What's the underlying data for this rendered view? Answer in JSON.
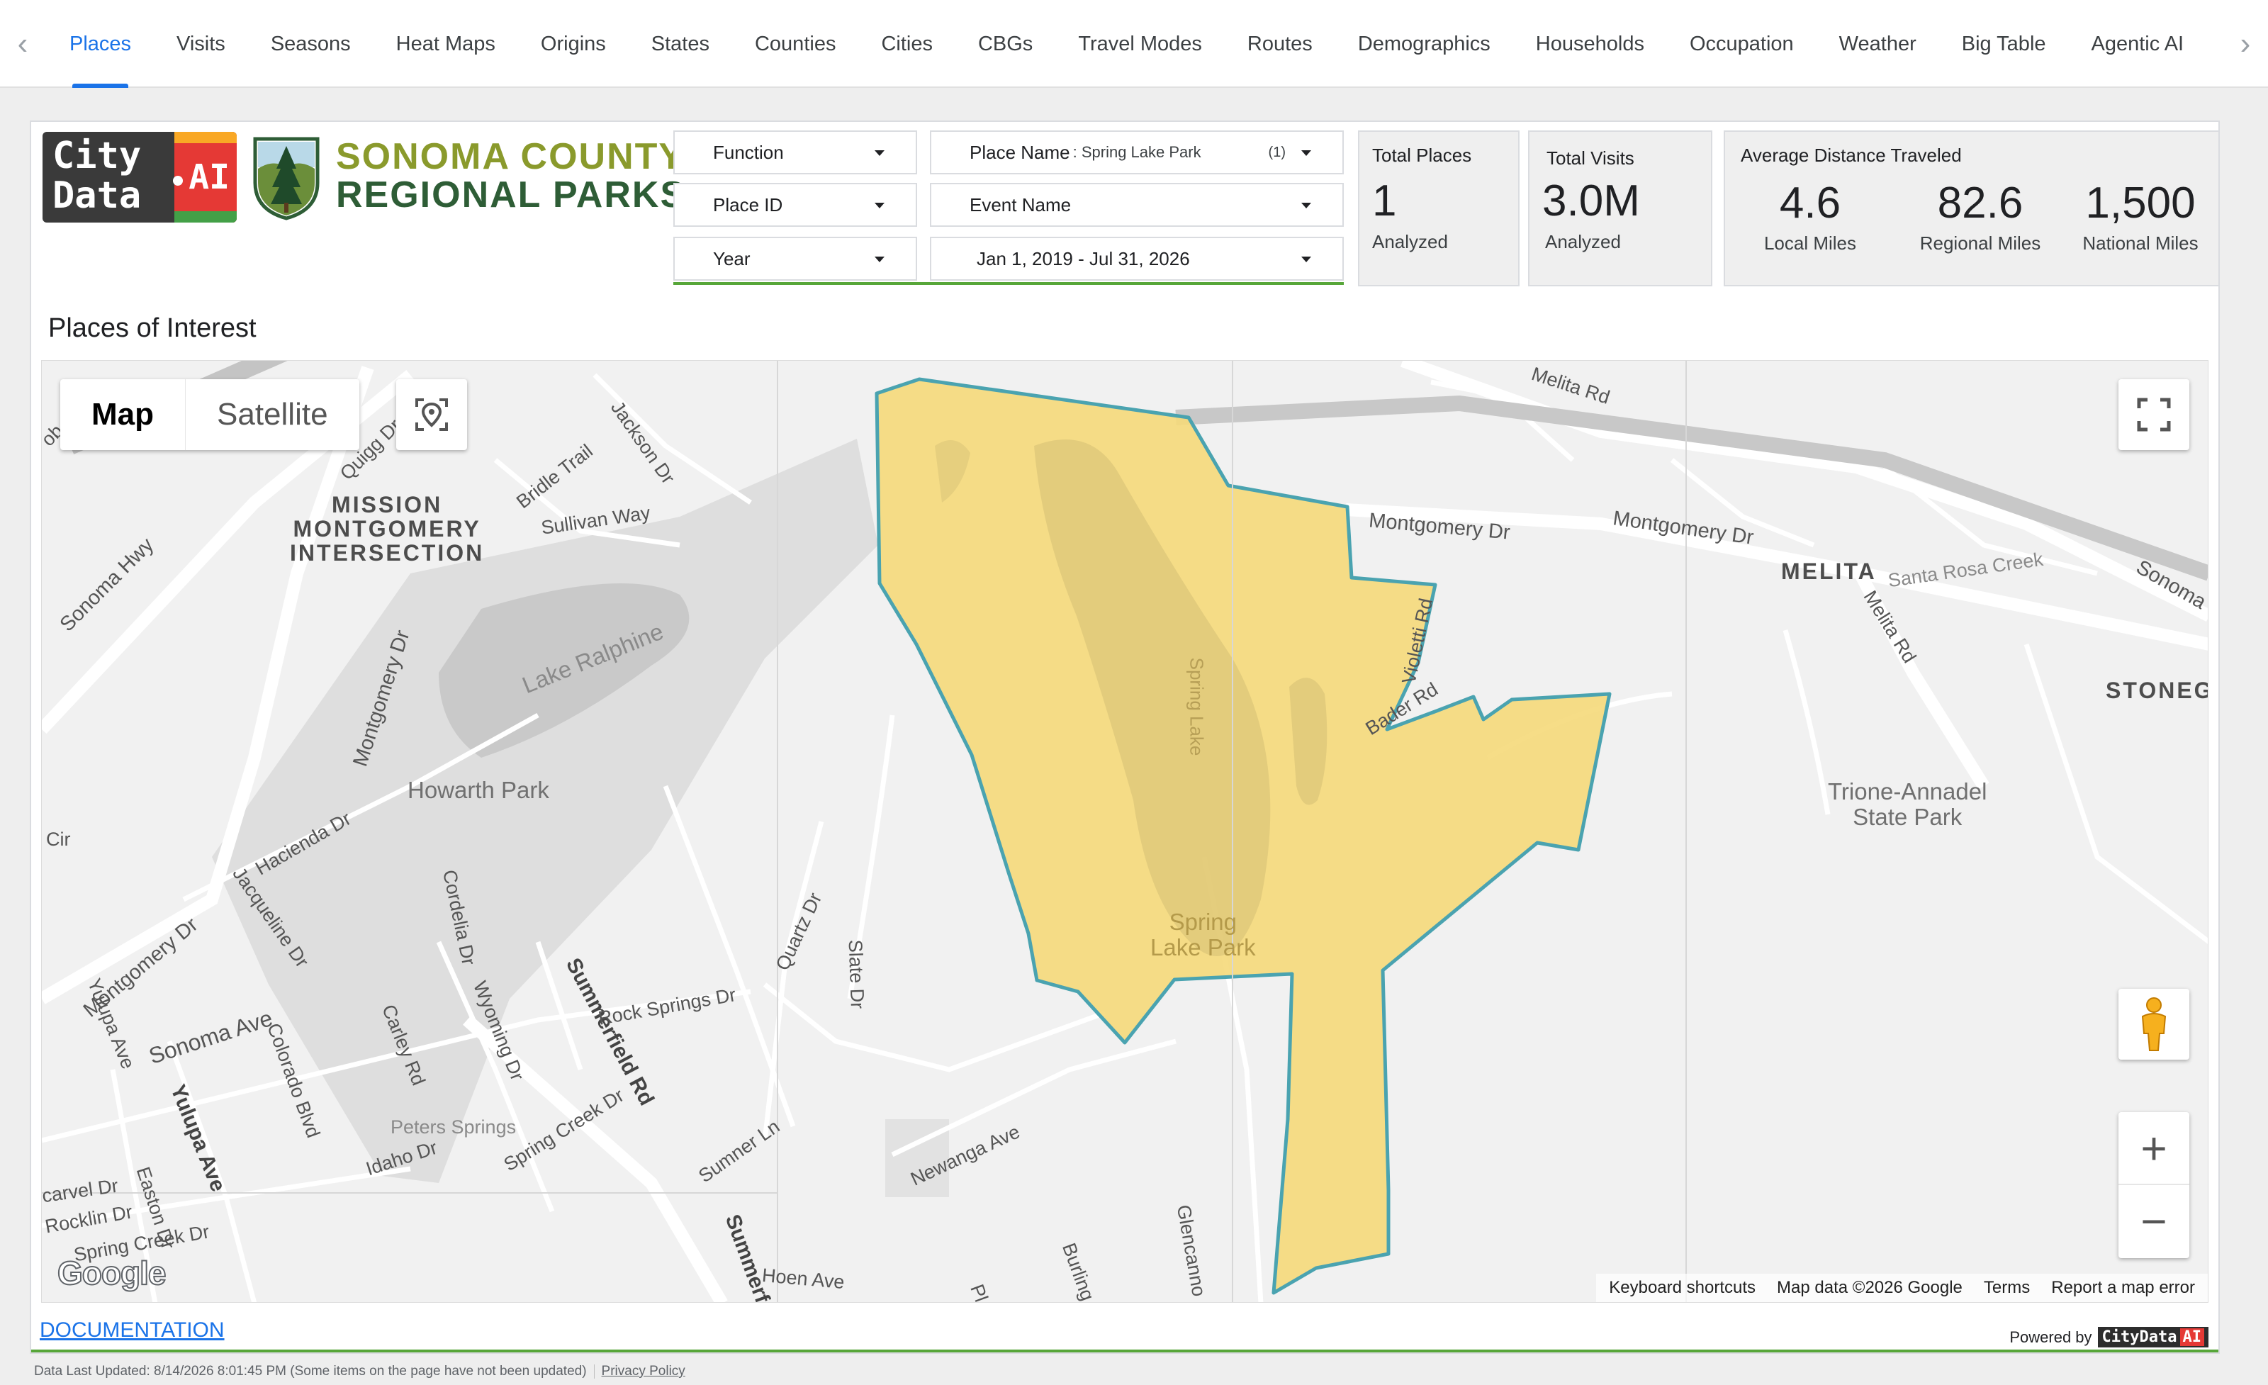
{
  "nav": {
    "tabs": [
      "Places",
      "Visits",
      "Seasons",
      "Heat Maps",
      "Origins",
      "States",
      "Counties",
      "Cities",
      "CBGs",
      "Travel Modes",
      "Routes",
      "Demographics",
      "Households",
      "Occupation",
      "Weather",
      "Big Table",
      "Agentic AI"
    ],
    "active_index": 0
  },
  "branding": {
    "citydata_logo_text": "City\nData",
    "citydata_logo_ai": "AI",
    "org_line1": "SONOMA COUNTY",
    "org_line2": "REGIONAL PARKS"
  },
  "filters": {
    "function": "Function",
    "place_name_label": "Place Name",
    "place_name_value": ": Spring Lake Park",
    "place_name_count": "(1)",
    "place_id": "Place ID",
    "event_name": "Event Name",
    "year": "Year",
    "date_range": "Jan 1, 2019 - Jul 31, 2026"
  },
  "stats": {
    "total_places": {
      "title": "Total Places",
      "value": "1",
      "label": "Analyzed"
    },
    "total_visits": {
      "title": "Total Visits",
      "value": "3.0M",
      "label": "Analyzed"
    },
    "avg_distance": {
      "title": "Average Distance Traveled",
      "local": {
        "value": "4.6",
        "label": "Local Miles"
      },
      "regional": {
        "value": "82.6",
        "label": "Regional Miles"
      },
      "national": {
        "value": "1,500",
        "label": "National Miles"
      }
    }
  },
  "section_title": "Places of Interest",
  "map": {
    "type_map": "Map",
    "type_satellite": "Satellite",
    "polygon_fill": "#f5d97a",
    "polygon_stroke": "#4aa3b0",
    "labels": {
      "mission": "MISSION\nMONTGOMERY\nINTERSECTION",
      "melita": "MELITA",
      "stoneg": "STONEG",
      "lake_ralphine": "Lake Ralphine",
      "howarth_park": "Howarth Park",
      "spring_lake_park": "Spring\nLake Park",
      "spring_lake": "Spring Lake",
      "trione": "Trione-Annadel\nState Park",
      "peters_springs": "Peters Springs",
      "sonoma_hwy": "Sonoma Hwy",
      "montgomery_dr_1": "Montgomery Dr",
      "montgomery_dr_2": "Montgomery Dr",
      "montgomery_dr_3": "Montgomery Dr",
      "montgomery_dr_4": "Montgomery Dr",
      "melita_rd_1": "Melita Rd",
      "melita_rd_2": "Melita Rd",
      "santa_rosa_creek": "Santa Rosa Creek",
      "sonoma_right": "Sonoma",
      "quigg_dr": "Quigg Dr",
      "bridle_trail": "Bridle Trail",
      "jackson_dr": "Jackson Dr",
      "sullivan_way": "Sullivan Way",
      "violetti_rd": "Violetti Rd",
      "bader_rd": "Bader Rd",
      "hacienda_dr": "Hacienda Dr",
      "jacqueline_dr": "Jacqueline Dr",
      "cordelia_dr": "Cordelia Dr",
      "summerfield_rd": "Summerfield Rd",
      "summerfield_bottom": "Summerf",
      "quartz_dr": "Quartz Dr",
      "slate_dr": "Slate Dr",
      "rock_springs_dr": "Rock Springs Dr",
      "sonoma_ave": "Sonoma Ave",
      "yulupa_ave_1": "Yulupa Ave",
      "yulupa_ave_2": "Yulupa Ave",
      "colorado_blvd": "Colorado Blvd",
      "carley_rd": "Carley Rd",
      "wyoming_dr": "Wyoming Dr",
      "spring_creek_dr_1": "Spring Creek Dr",
      "spring_creek_dr_2": "Spring Creek Dr",
      "idaho_dr": "Idaho Dr",
      "sumner_ln": "Sumner Ln",
      "newanga_ave": "Newanga Ave",
      "hoen_ave": "Hoen Ave",
      "burlingame": "Burling",
      "glencanno": "Glencanno",
      "carvel_dr": "carvel Dr",
      "easton_dr": "Easton Dr",
      "rocklin_dr": "Rocklin Dr",
      "cir": "Cir",
      "ob": "ob",
      "pl": "Pl"
    },
    "attribution": {
      "shortcuts": "Keyboard shortcuts",
      "data": "Map data ©2026 Google",
      "terms": "Terms",
      "report": "Report a map error"
    },
    "google": "Google"
  },
  "documentation_link": "DOCUMENTATION",
  "powered_by": "Powered by",
  "powered_badge": "CityData",
  "powered_badge_ai": "AI",
  "footer": {
    "updated": "Data Last Updated: 8/14/2026 8:01:45 PM (Some items on the page have not been updated)",
    "privacy": "Privacy Policy"
  }
}
